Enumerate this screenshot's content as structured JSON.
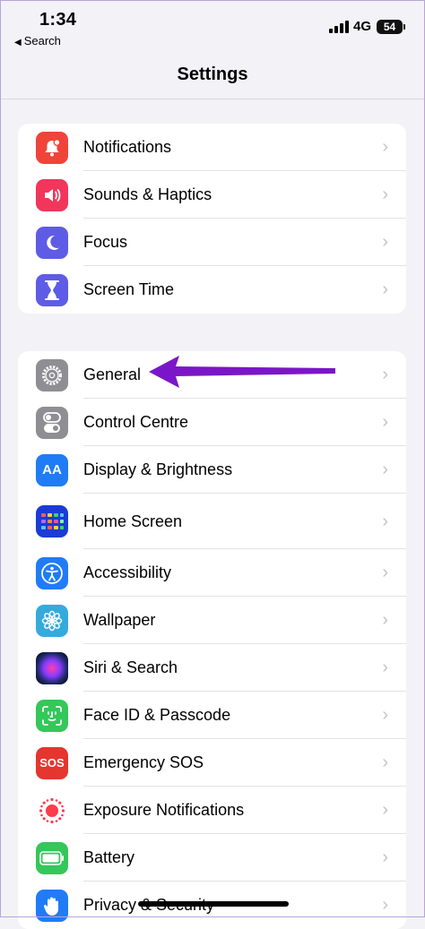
{
  "status_bar": {
    "time": "1:34",
    "back_label": "Search",
    "network": "4G",
    "battery": "54"
  },
  "nav": {
    "title": "Settings"
  },
  "group1": [
    {
      "label": "Notifications"
    },
    {
      "label": "Sounds & Haptics"
    },
    {
      "label": "Focus"
    },
    {
      "label": "Screen Time"
    }
  ],
  "group2": [
    {
      "label": "General"
    },
    {
      "label": "Control Centre"
    },
    {
      "label": "Display & Brightness"
    },
    {
      "label": "Home Screen"
    },
    {
      "label": "Accessibility"
    },
    {
      "label": "Wallpaper"
    },
    {
      "label": "Siri & Search"
    },
    {
      "label": "Face ID & Passcode"
    },
    {
      "label": "Emergency SOS"
    },
    {
      "label": "Exposure Notifications"
    },
    {
      "label": "Battery"
    },
    {
      "label": "Privacy & Security"
    }
  ],
  "icons": {
    "sos_text": "SOS",
    "aa_text": "AA"
  },
  "colors": {
    "notifications": "#f0433a",
    "sounds": "#f2355b",
    "focus": "#5e5ce6",
    "screen_time": "#5e5ce6",
    "general": "#8e8e93",
    "control": "#8e8e93",
    "display": "#1f7cf6",
    "accessibility": "#1f7cf6",
    "wallpaper": "#35aadc",
    "face_id": "#34c759",
    "sos": "#e5352f",
    "battery": "#34c759",
    "annotation_arrow": "#7b16c8"
  }
}
